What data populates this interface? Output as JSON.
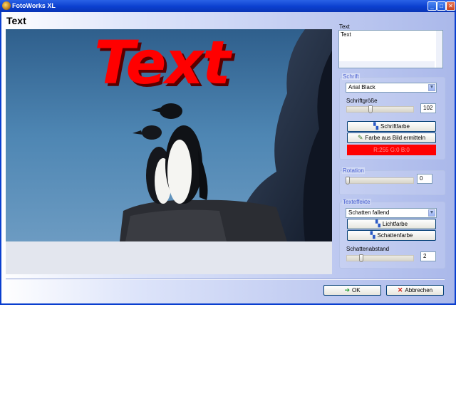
{
  "window": {
    "title": "FotoWorks XL",
    "controls": {
      "minimize": "_",
      "maximize": "□",
      "close": "✕"
    }
  },
  "page_title": "Text",
  "preview": {
    "overlay_text": "Text",
    "overlay_color": "#ff0000"
  },
  "text_section": {
    "label": "Text",
    "value": "Text"
  },
  "font_section": {
    "label": "Schrift",
    "font_name": "Arial Black",
    "size_label": "Schriftgröße",
    "size_value": "102",
    "size_level": 0.35,
    "color_button": "Schriftfarbe",
    "pick_button": "Farbe aus Bild ermitteln",
    "color_readout": "R:255 G:0 B:0",
    "current_color": "#ff0000"
  },
  "rotation_section": {
    "label": "Rotation",
    "value": "0",
    "level": 0.0
  },
  "effects_section": {
    "label": "Texteffekte",
    "effect_value": "Schatten fallend",
    "light_button": "Lichtfarbe",
    "shadow_button": "Schattenfarbe",
    "distance_label": "Schattenabstand",
    "distance_value": "2",
    "distance_level": 0.2
  },
  "footer": {
    "ok_label": "OK",
    "cancel_label": "Abbrechen"
  },
  "icons": {
    "app": "app-icon",
    "color_palette": "palette-icon",
    "eyedropper": "eyedropper-icon",
    "ok": "arrow-right-icon",
    "cancel": "red-x-icon"
  }
}
